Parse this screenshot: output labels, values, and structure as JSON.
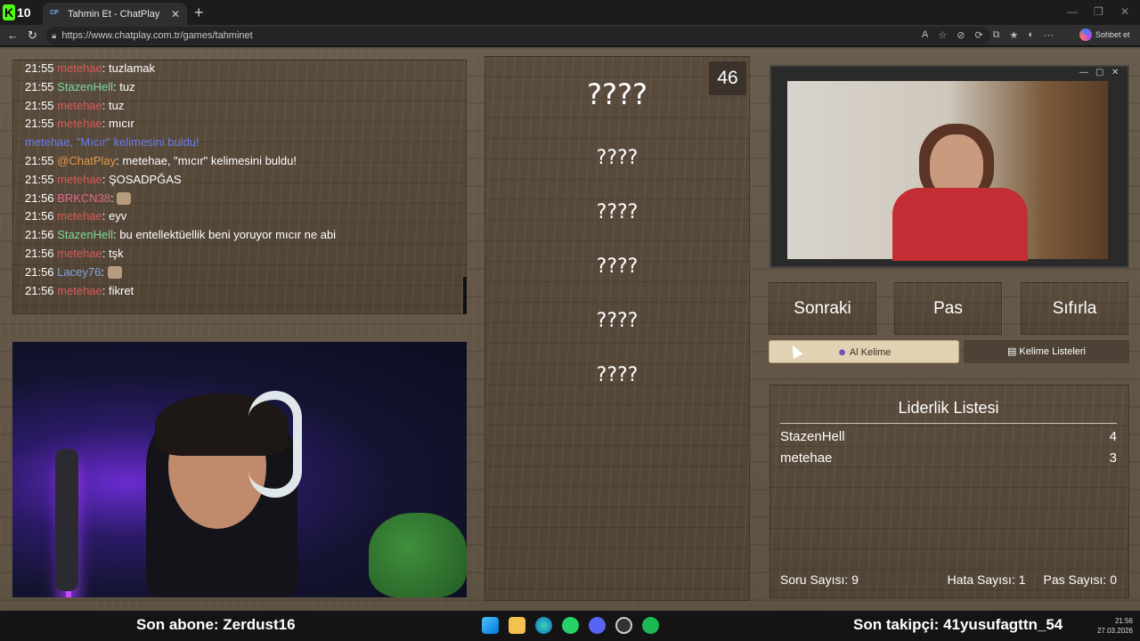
{
  "browser": {
    "tab_title": "Tahmin Et - ChatPlay",
    "tab_favicon": "CP",
    "url": "https://www.chatplay.com.tr/games/tahminet",
    "copilot_label": "Sohbet et",
    "app_logo_text": "10"
  },
  "chat": {
    "messages": [
      {
        "time": "21:55",
        "user": "metehae",
        "user_color": "red",
        "text": ": tuzlamak"
      },
      {
        "time": "21:55",
        "user": "StazenHell",
        "user_color": "green",
        "text": ": tuz"
      },
      {
        "time": "21:55",
        "user": "metehae",
        "user_color": "red",
        "text": ": tuz"
      },
      {
        "time": "21:55",
        "user": "metehae",
        "user_color": "red",
        "text": ": mıcır"
      },
      {
        "time": "",
        "user": "",
        "user_color": "system",
        "text": "metehae, \"Mıcır\" kelimesini buldu!"
      },
      {
        "time": "21:55",
        "user": "@ChatPlay",
        "user_color": "orange",
        "text": ": metehae, \"mıcır\" kelimesini buldu!"
      },
      {
        "time": "21:55",
        "user": "metehae",
        "user_color": "red",
        "text": ": ŞOSADPĞAS"
      },
      {
        "time": "21:56",
        "user": "BRKCN38",
        "user_color": "pink",
        "text": ": "
      },
      {
        "time": "21:56",
        "user": "metehae",
        "user_color": "red",
        "text": ": eyv"
      },
      {
        "time": "21:56",
        "user": "StazenHell",
        "user_color": "green",
        "text": ": bu entellektüellik beni yoruyor mıcır ne abi"
      },
      {
        "time": "21:56",
        "user": "metehae",
        "user_color": "red",
        "text": ": tşk"
      },
      {
        "time": "21:56",
        "user": "Lacey76",
        "user_color": "blue",
        "text": ": "
      },
      {
        "time": "21:56",
        "user": "metehae",
        "user_color": "red",
        "text": ": fikret"
      }
    ]
  },
  "game": {
    "counter": "46",
    "hidden_words": [
      "????",
      "????",
      "????",
      "????",
      "????",
      "????"
    ]
  },
  "controls": {
    "next": "Sonraki",
    "pass": "Pas",
    "reset": "Sıfırla",
    "get_word": "Al Kelime",
    "word_lists": "Kelime Listeleri"
  },
  "leaderboard": {
    "title": "Liderlik Listesi",
    "rows": [
      {
        "name": "StazenHell",
        "score": "4"
      },
      {
        "name": "metehae",
        "score": "3"
      }
    ],
    "question_count": "Soru Sayısı: 9",
    "error_count": "Hata Sayısı: 1",
    "pass_count": "Pas Sayısı: 0"
  },
  "overlay": {
    "last_sub": "Son abone: Zerdust16",
    "last_follower": "Son takipçi: 41yusufagttn_54"
  },
  "clock": {
    "time": "21:56",
    "date": "27.03.2026"
  },
  "colors": {
    "red": "#d65a5a",
    "green": "#7bd89d",
    "orange": "#e79a4b",
    "pink": "#e06a8a",
    "blue": "#7fa6e6",
    "system": "#6a7df0",
    "accent_button": "#e0d2b2"
  }
}
